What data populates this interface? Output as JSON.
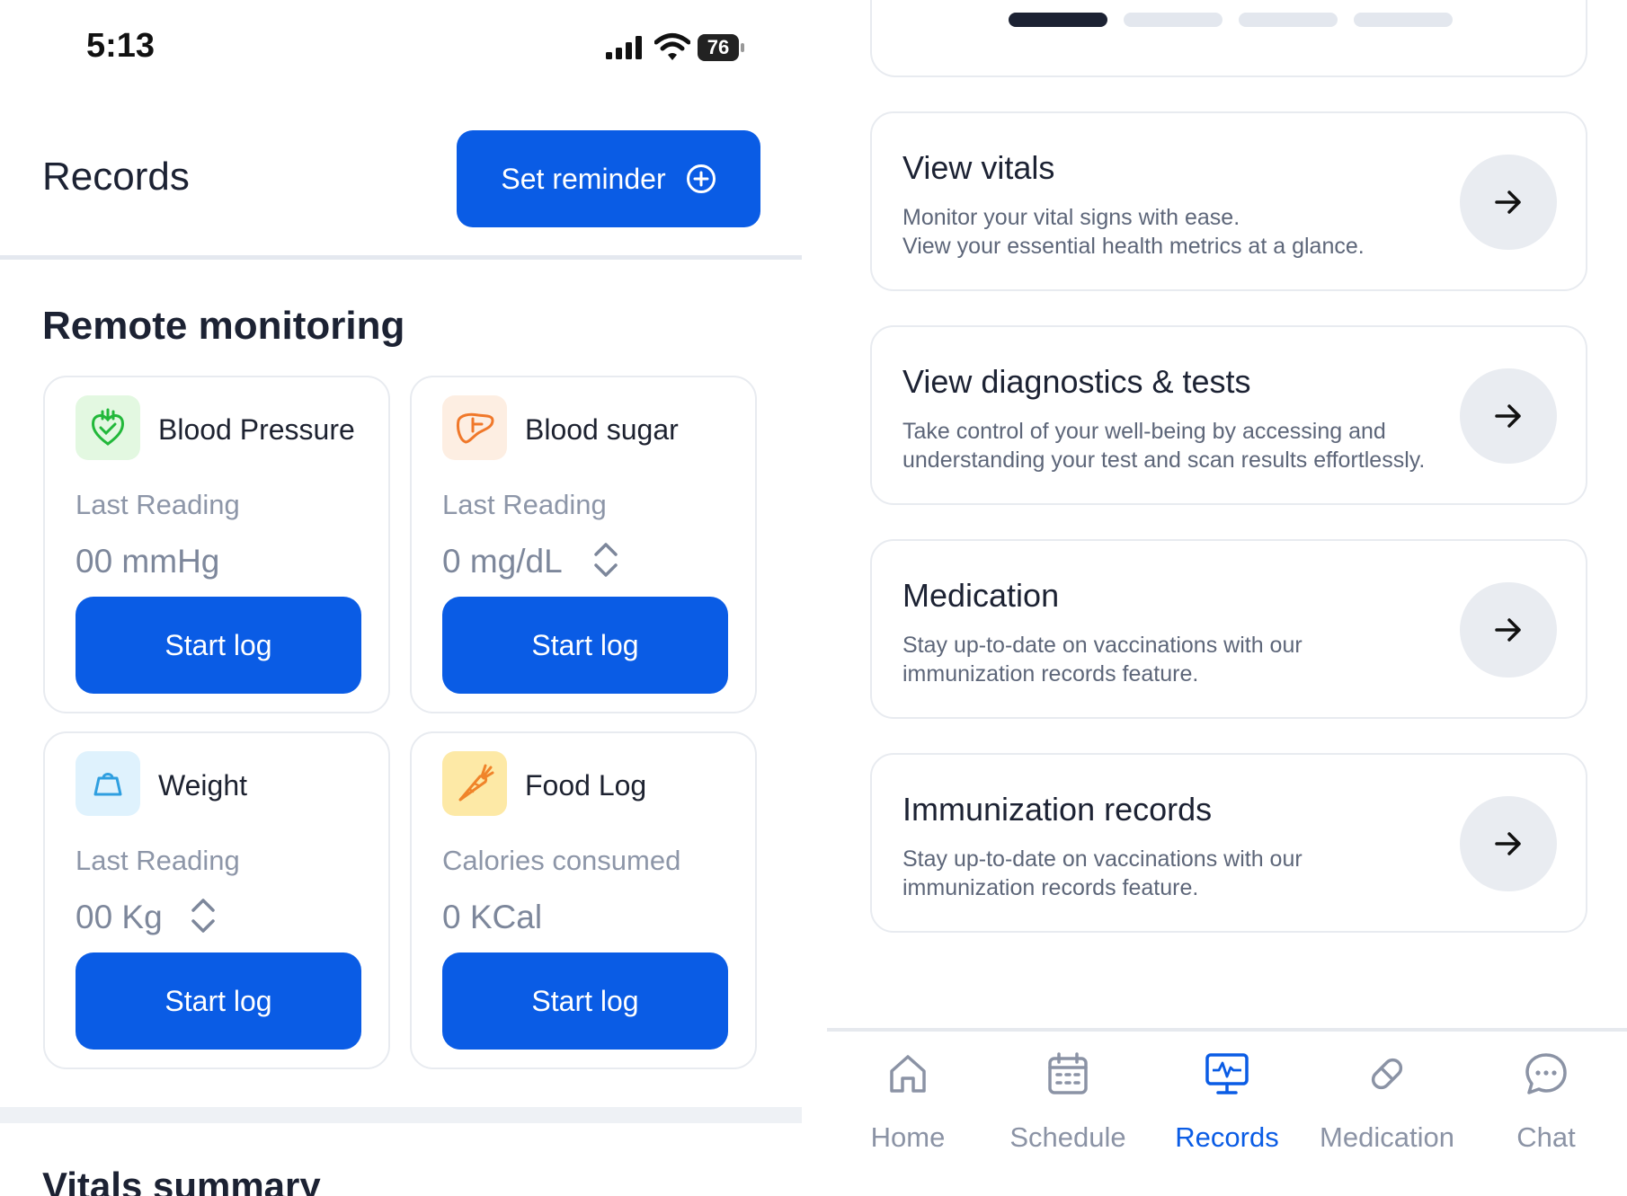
{
  "status_bar": {
    "time": "5:13",
    "battery": "76"
  },
  "header": {
    "title": "Records",
    "reminder_label": "Set reminder"
  },
  "remote_monitoring": {
    "title": "Remote monitoring",
    "cards": [
      {
        "title": "Blood Pressure",
        "sub_label": "Last Reading",
        "value": "00 mmHg",
        "button": "Start log",
        "icon": "heart-icon",
        "icon_bg": "#e3f8e1",
        "icon_color": "#22b83a"
      },
      {
        "title": "Blood sugar",
        "sub_label": "Last Reading",
        "value": "0 mg/dL",
        "button": "Start log",
        "icon": "liver-icon",
        "icon_bg": "#fdeee2",
        "icon_color": "#f0782a"
      },
      {
        "title": "Weight",
        "sub_label": "Last Reading",
        "value": "00 Kg",
        "button": "Start log",
        "icon": "scale-icon",
        "icon_bg": "#dff2fd",
        "icon_color": "#2f9fe0"
      },
      {
        "title": "Food Log",
        "sub_label": "Calories consumed",
        "value": "0 KCal",
        "button": "Start log",
        "icon": "carrot-icon",
        "icon_bg": "#fde9a6",
        "icon_color": "#f0842a"
      }
    ]
  },
  "vitals_summary": {
    "title": "Vitals summary"
  },
  "carousel": {
    "active_index": 0,
    "count": 4
  },
  "records_list": [
    {
      "title": "View vitals",
      "line1": "Monitor your vital signs with ease.",
      "line2": "View your essential health metrics at a glance."
    },
    {
      "title": "View diagnostics & tests",
      "line1": "Take control of your well-being by accessing and",
      "line2": "understanding your test and scan results effortlessly."
    },
    {
      "title": "Medication",
      "line1": "Stay up-to-date on vaccinations with our",
      "line2": "immunization records feature."
    },
    {
      "title": "Immunization records",
      "line1": "Stay up-to-date on vaccinations with our",
      "line2": "immunization records feature."
    }
  ],
  "bottom_nav": {
    "active": "Records",
    "items": [
      {
        "label": "Home",
        "icon": "home-icon"
      },
      {
        "label": "Schedule",
        "icon": "calendar-icon"
      },
      {
        "label": "Records",
        "icon": "monitor-icon"
      },
      {
        "label": "Medication",
        "icon": "pill-icon"
      },
      {
        "label": "Chat",
        "icon": "chat-icon"
      }
    ]
  },
  "colors": {
    "primary": "#0a5ce5",
    "muted_text": "#8d96a8",
    "border": "#e8ebf0",
    "arrow_bg": "#e9ecf1"
  }
}
